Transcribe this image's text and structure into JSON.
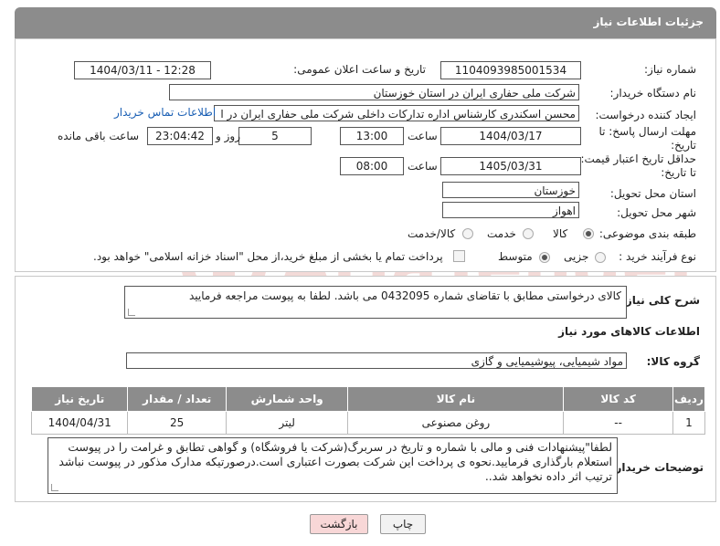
{
  "header": {
    "title": "جزئیات اطلاعات نیاز"
  },
  "form": {
    "need_number_label": "شماره نیاز:",
    "need_number": "1104093985001534",
    "announce_label": "تاریخ و ساعت اعلان عمومی:",
    "announce_value": "1404/03/11 - 12:28",
    "buyer_org_label": "نام دستگاه خریدار:",
    "buyer_org": "شرکت ملی حفاری ایران در استان خوزستان",
    "requester_label": "ایجاد کننده درخواست:",
    "requester": "محسن اسکندری کارشناس اداره تدارکات داخلی  شرکت ملی حفاری ایران در ا",
    "contact_link": "اطلاعات تماس خریدار",
    "reply_deadline_label_1": "مهلت ارسال پاسخ: تا",
    "reply_deadline_label_2": "تاریخ:",
    "reply_date": "1404/03/17",
    "time_label": "ساعت",
    "reply_time": "13:00",
    "days": "5",
    "days_label": "روز و",
    "remaining": "23:04:42",
    "remaining_label": "ساعت باقی مانده",
    "price_validity_label_1": "حداقل تاریخ اعتبار قیمت:",
    "price_validity_label_2": "تا تاریخ:",
    "validity_date": "1405/03/31",
    "validity_time_label": "ساعت",
    "validity_time": "08:00",
    "province_label": "استان محل تحویل:",
    "province": "خوزستان",
    "city_label": "شهر محل تحویل:",
    "city": "اهواز",
    "category_label": "طبقه بندی موضوعی:",
    "category_options": [
      "کالا",
      "خدمت",
      "کالا/خدمت"
    ],
    "process_label": "نوع فرآیند خرید :",
    "process_options": [
      "جزیی",
      "متوسط"
    ],
    "payment_note": "پرداخت تمام یا بخشی از مبلغ خرید،از محل \"اسناد خزانه اسلامی\" خواهد بود."
  },
  "details": {
    "description_label": "شرح کلی نیاز:",
    "description": "کالای درخواستی مطابق با تقاضای شماره 0432095 می باشد. لطفا به پیوست مراجعه فرمایید",
    "goods_info_title": "اطلاعات کالاهای مورد نیاز",
    "goods_group_label": "گروه کالا:",
    "goods_group": "مواد شیمیایی، پیوشیمیایی و  گازی",
    "table": {
      "headers": [
        "ردیف",
        "کد کالا",
        "نام کالا",
        "واحد شمارش",
        "تعداد / مقدار",
        "تاریخ نیاز"
      ],
      "rows": [
        [
          "1",
          "--",
          "روغن مصنوعی",
          "لیتر",
          "25",
          "1404/04/31"
        ]
      ]
    },
    "buyer_notes_label": "توضیحات خریدار:",
    "buyer_notes": "لطفا\"پیشنهادات فنی و مالی با شماره و تاریخ در سربرگ(شرکت یا فروشگاه) و گواهی تطابق و غرامت را در پیوست استعلام بارگذاری فرمایید.نحوه ی پرداخت این شرکت بصورت اعتباری است.درصورتیکه مدارک مذکور در پیوست نباشد ترتیب اثر داده نخواهد شد.."
  },
  "buttons": {
    "print": "چاپ",
    "back": "بازگشت"
  },
  "watermark": {
    "text": "AriaTender.neT"
  },
  "colors": {
    "header_bg": "#8c8c8c",
    "link": "#1a5fb4",
    "back_btn": "#f8d7d7",
    "watermark": "#c0392b"
  }
}
